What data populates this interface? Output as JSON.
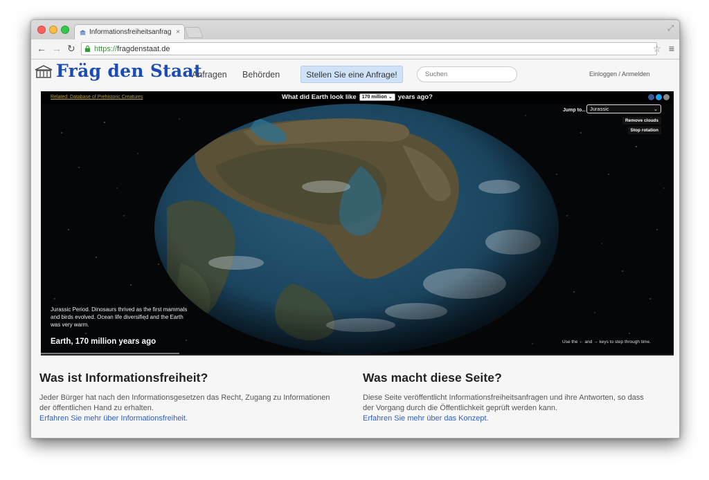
{
  "browser": {
    "tab_title": "Informationsfreiheitsanfrag",
    "tab_close": "×",
    "url_scheme": "https://",
    "url_host": "fragdenstaat.de"
  },
  "site": {
    "title": "Fräg den Staat",
    "nav": [
      "Anfragen",
      "Behörden"
    ],
    "cta": "Stellen Sie eine Anfrage!",
    "search_placeholder": "Suchen",
    "login": "Einloggen / Anmelden"
  },
  "embed": {
    "link": "Related: Database of Prehistoric Creatures",
    "question_prefix": "What did Earth look like",
    "years_value": "170 million",
    "question_suffix": "years ago?",
    "jump_label": "Jump to...",
    "jump_value": "Jurassic",
    "remove_clouds": "Remove clouds",
    "stop_rotation": "Stop rotation",
    "description": "Jurassic Period. Dinosaurs thrived as the first mammals and birds evolved. Ocean life diversified and the Earth was very warm.",
    "caption": "Earth, 170 million years ago",
    "hint": "Use the ← and → keys to step through time."
  },
  "info": {
    "left": {
      "heading": "Was ist Informationsfreiheit?",
      "text": "Jeder Bürger hat nach den Informationsgesetzen das Recht, Zugang zu Informationen der öffentlichen Hand zu erhalten.",
      "link": "Erfahren Sie mehr über Informationsfreiheit."
    },
    "right": {
      "heading": "Was macht diese Seite?",
      "text": "Diese Seite veröffentlicht Informationsfreiheitsanfragen und ihre Antworten, so dass der Vorgang durch die Öffentlichkeit geprüft werden kann.",
      "link": "Erfahren Sie mehr über das Konzept."
    }
  }
}
